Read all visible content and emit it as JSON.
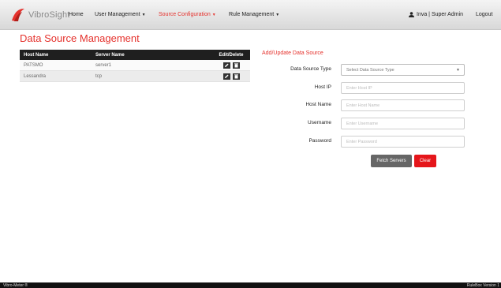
{
  "brand": {
    "name": "VibroSight"
  },
  "nav": {
    "items": [
      {
        "label": "Home",
        "caret": ""
      },
      {
        "label": "User Management",
        "caret": "▼"
      },
      {
        "label": "Source Configuration",
        "caret": "▼",
        "active": true
      },
      {
        "label": "Rule Management",
        "caret": "▼"
      }
    ],
    "user": "Inva | Super Admin",
    "logout": "Logout"
  },
  "page": {
    "title": "Data Source Management"
  },
  "table": {
    "columns": [
      "Host Name",
      "Server Name",
      "Edit/Delete"
    ],
    "rows": [
      {
        "host": "PATSMO",
        "server": "server1"
      },
      {
        "host": "Lessandra",
        "server": "tcp"
      }
    ]
  },
  "form": {
    "title": "Add/Update Data Source",
    "source_type": {
      "label": "Data Source Type",
      "value": "Select Data Source Type"
    },
    "host_ip": {
      "label": "Host IP",
      "placeholder": "Enter Host IP"
    },
    "host_name": {
      "label": "Host Name",
      "placeholder": "Enter Host Name"
    },
    "username": {
      "label": "Username",
      "placeholder": "Enter Username"
    },
    "password": {
      "label": "Password",
      "placeholder": "Enter Password"
    },
    "fetch_label": "Fetch Servers",
    "clear_label": "Clear"
  },
  "footer": {
    "left": "Vibro-Meter ®",
    "right": "RuleBox Version 1"
  },
  "colors": {
    "accent": "#e5322d",
    "nav_bg": "#e4e4e4",
    "table_head": "#1f1f1f",
    "clear_button": "#e5161b",
    "fetch_button": "#666666"
  }
}
